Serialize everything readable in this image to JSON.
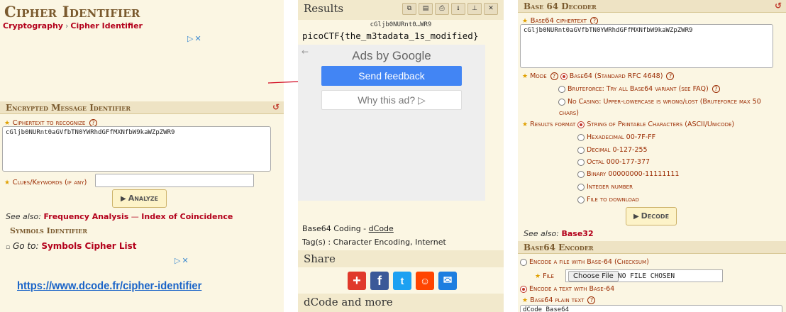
{
  "left": {
    "title": "Cipher Identifier",
    "breadcrumb": {
      "root": "Cryptography",
      "sep": "›",
      "current": "Cipher Identifier"
    },
    "ad_choices": "▷✕",
    "section_title": "Encrypted Message Identifier",
    "ciphertext_label": "Ciphertext to recognize",
    "ciphertext_value": "cGljb0NURnt0aGVfbTN0YWRhdGFfMXNfbW9kaWZpZWR9",
    "clues_label": "Clues/Keywords (if any)",
    "analyze_button": "Analyze",
    "see_also_prefix": "See also:",
    "see_also_link1": "Frequency Analysis",
    "see_also_dash": "—",
    "see_also_link2": "Index of Coincidence",
    "symbols_title": "Symbols Identifier",
    "goto_prefix": "Go to:",
    "goto_link": "Symbols Cipher List",
    "url": "https://www.dcode.fr/cipher-identifier"
  },
  "middle": {
    "results_title": "Results",
    "results_hash": "cGljb0NURnt0…WR9",
    "flag": "picoCTF{the_m3tadata_1s_modified}",
    "ads_by_google": "Ads by Google",
    "send_feedback": "Send feedback",
    "why_this_ad": "Why this ad? ▷",
    "coding_prefix": "Base64 Coding - ",
    "coding_link": "dCode",
    "tags": "Tag(s) : Character Encoding, Internet",
    "share_title": "Share",
    "more_title": "dCode and more"
  },
  "right": {
    "decoder_title": "Base 64 Decoder",
    "ciphertext_label": "Base64 ciphertext",
    "ciphertext_value": "cGljb0NURnt0aGVfbTN0YWRhdGFfMXNfbW9kaWZpZWR9",
    "mode_label": "Mode",
    "mode_opt1": "Base64 (Standard RFC 4648)",
    "mode_opt2": "Bruteforce: Try all Base64 variant (see FAQ)",
    "mode_opt3a": "No Casing: Upper-lowercase is wrong/lost (Bruteforce max 50",
    "mode_opt3b": "chars)",
    "results_label": "Results format",
    "res_opt1": "String of Printable Characters (ASCII/Unicode)",
    "res_opt2": "Hexadecimal 00-7F-FF",
    "res_opt3": "Decimal 0-127-255",
    "res_opt4": "Octal 000-177-377",
    "res_opt5": "Binary 00000000-11111111",
    "res_opt6": "Integer number",
    "res_opt7": "File to download",
    "decode_button": "Decode",
    "see_also_prefix": "See also:",
    "see_also_link": "Base32",
    "encoder_title": "Base64 Encoder",
    "enc_opt1": "Encode a file with Base-64 (Checksum)",
    "file_label": "File",
    "choose_file": "Choose File",
    "no_file": "NO FILE CHOSEN",
    "enc_opt2": "Encode a text with Base-64",
    "plain_label": "Base64 plain text",
    "plain_value": "dCode Base64"
  },
  "colors": {
    "accent": "#b3001b",
    "header_brown": "#7a5a2e",
    "panel_bg": "#fbf6e3",
    "google_blue": "#4285f4"
  }
}
